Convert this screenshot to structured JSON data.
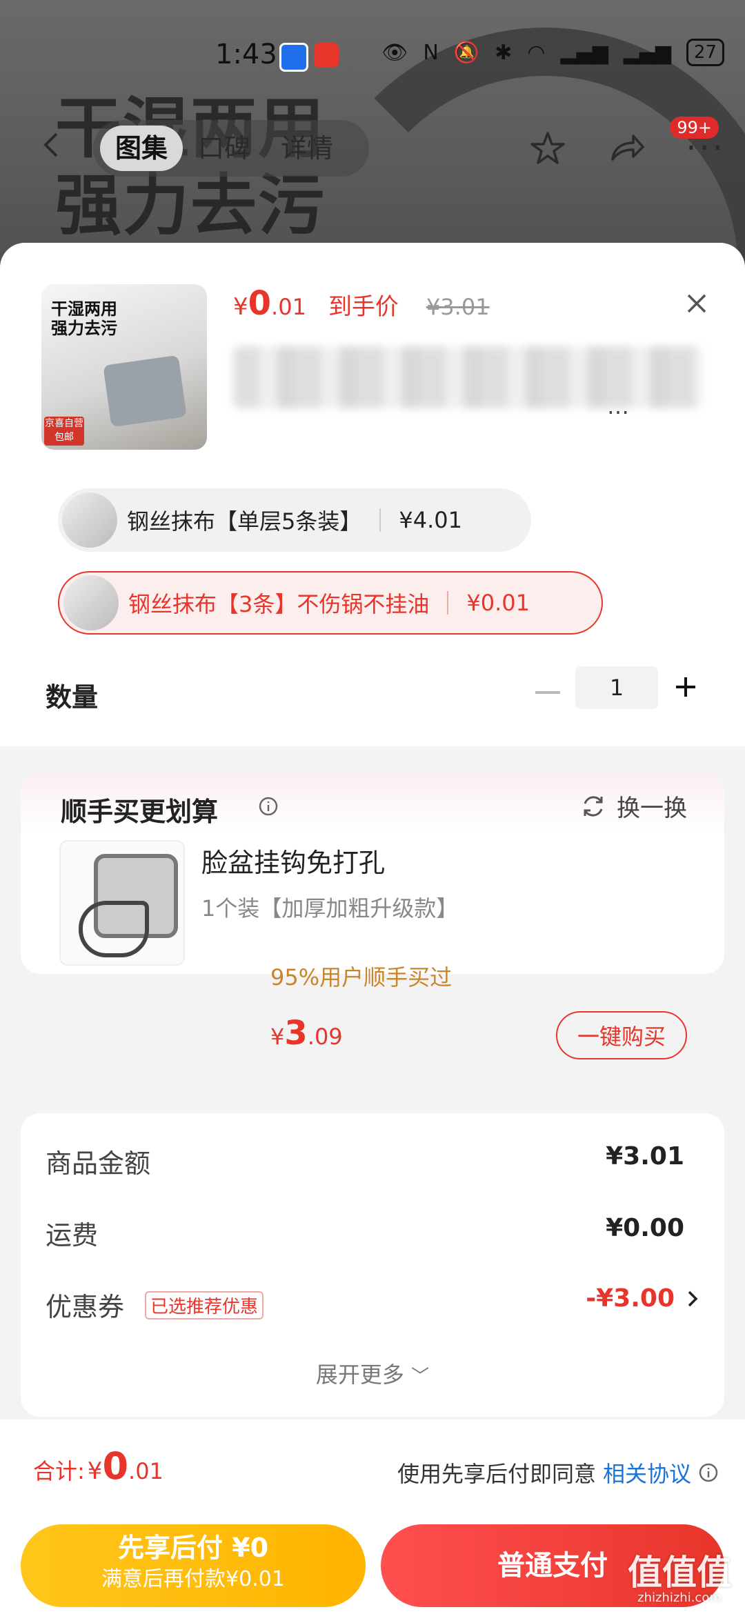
{
  "status_bar": {
    "time": "1:43",
    "battery": "27"
  },
  "nav": {
    "tabs": [
      "图集",
      "口碑",
      "详情"
    ],
    "active_tab": 0,
    "badge": "99+",
    "bg_title": [
      "干湿两用",
      "强力去污"
    ]
  },
  "product": {
    "currency": "¥",
    "price_int": "0",
    "price_dec": ".01",
    "price_label": "到手价",
    "original_price": "¥3.01",
    "title_tail": "…",
    "thumb_text": [
      "干湿两用",
      "强力去污"
    ],
    "thumb_tag": "京喜自营 包邮"
  },
  "skus": [
    {
      "name": "钢丝抹布【单层5条装】",
      "price": "¥4.01",
      "selected": false
    },
    {
      "name": "钢丝抹布【3条】不伤锅不挂油",
      "price": "¥0.01",
      "selected": true
    }
  ],
  "quantity": {
    "label": "数量",
    "value": "1"
  },
  "recommend": {
    "title": "顺手买更划算",
    "swap_label": "换一换",
    "item_name": "脸盆挂钩免打孔",
    "item_spec": "1个装【加厚加粗升级款】",
    "item_social": "95%用户顺手买过",
    "currency": "¥",
    "price_int": "3",
    "price_dec": ".09",
    "buy_label": "一键购买"
  },
  "summary": {
    "rows": [
      {
        "label": "商品金额",
        "value": "¥3.01"
      },
      {
        "label": "运费",
        "value": "¥0.00"
      },
      {
        "label": "优惠券",
        "tag": "已选推荐优惠",
        "value": "-¥3.00"
      }
    ],
    "expand_label": "展开更多"
  },
  "bottom": {
    "total_label": "合计:",
    "currency": "¥",
    "total_int": "0",
    "total_dec": ".01",
    "agree_text": "使用先享后付即同意",
    "agree_link": "相关协议",
    "pay_later_l1": "先享后付 ¥0",
    "pay_later_l2": "满意后再付款¥0.01",
    "pay_normal": "普通支付"
  },
  "watermark": {
    "main": "值值值",
    "sub": "zhizhizhi.com"
  },
  "colors": {
    "accent": "#e8352b",
    "link": "#1a73d9",
    "pay_later": "#ffbf14"
  }
}
